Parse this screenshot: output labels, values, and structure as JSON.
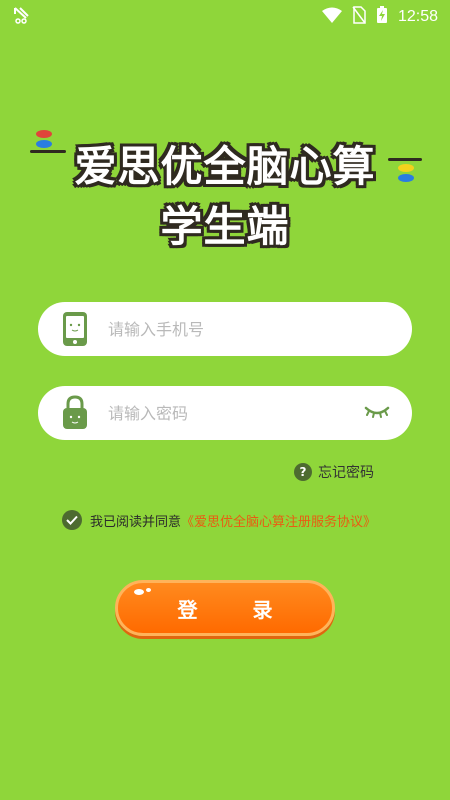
{
  "status_bar": {
    "time": "12:58",
    "icons": [
      "wind-vane-icon",
      "wifi-icon",
      "no-sim-icon",
      "battery-charging-icon"
    ]
  },
  "title": {
    "line1": "爱思优全脑心算",
    "line2": "学生端",
    "deco_colors": [
      "#e0453a",
      "#2a7de1",
      "#f3d21c"
    ]
  },
  "phone_field": {
    "placeholder": "请输入手机号",
    "value": "",
    "icon": "phone-icon"
  },
  "password_field": {
    "placeholder": "请输入密码",
    "value": "",
    "icon": "lock-icon",
    "toggle_icon": "eye-closed-icon"
  },
  "forgot_password": {
    "label": "忘记密码",
    "icon": "question-icon"
  },
  "agreement": {
    "prefix": "我已阅读并同意",
    "link": "《爱思优全脑心算注册服务协议》",
    "checked": true
  },
  "login_button": {
    "label": "登 录",
    "color": "#ff7a10"
  },
  "theme": {
    "background": "#8fd63a",
    "icon_green": "#5a8a3c",
    "link_orange": "#e85d13"
  }
}
